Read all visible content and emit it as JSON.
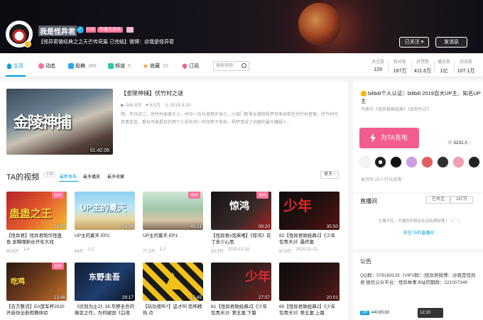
{
  "header": {
    "username": "我是怪异君",
    "level": "LV6",
    "vip_label": "年度大会员",
    "signature": "【怪异君微经典之之天芒传奇篇 已完结】微博：@我是怪异君",
    "follow_label": "已关注 ▾",
    "message_label": "发消息"
  },
  "nav": {
    "tabs": [
      {
        "label": "主页",
        "count": ""
      },
      {
        "label": "动态",
        "count": ""
      },
      {
        "label": "投稿",
        "count": "385"
      },
      {
        "label": "频道",
        "count": "5"
      },
      {
        "label": "收藏",
        "count": "10"
      },
      {
        "label": "订阅",
        "count": ""
      }
    ],
    "search_placeholder": "搜索视频"
  },
  "stats": [
    {
      "label": "关注数",
      "value": "129"
    },
    {
      "label": "粉丝数",
      "value": "187万"
    },
    {
      "label": "获赞数",
      "value": "411.6万"
    },
    {
      "label": "播放数",
      "value": "1亿"
    },
    {
      "label": "阅读数",
      "value": "107.1万"
    }
  ],
  "featured": {
    "title": "【金陵神捕】伏竹村之谜",
    "thumb_text": "金陵神捕",
    "duration": "01:42:09",
    "plays": "246.8万",
    "likes": "6.5万",
    "date": "2019-9-20",
    "description": "明、冬日初二。伏竹村血案大火。村中一位长者意外身亡。六扇门新晋女捕快杨梦音奉命前往伏竹村查案。伏竹村内怪事连连，看似可能是另的两个人却在同一时间死于非命，杨梦音成了凶案的最大嫌疑人..."
  },
  "videos_section": {
    "title": "TA的视频",
    "count": "138",
    "sorts": [
      "最新发布",
      "最多播放",
      "最多收藏"
    ],
    "more_label": "更多 ›"
  },
  "videos": [
    {
      "title": "【怪异君】怪异君制作怪蛊 鱼 发糊喂粉丝开年大戏",
      "duration": "26:25",
      "plays": "90.6万",
      "extra": "1-6",
      "tag": "合作",
      "thumb_text": "蛊蛊之王"
    },
    {
      "title": "UP主的夏天 EP2",
      "duration": "54:38",
      "plays": "64万",
      "extra": "1-2",
      "tag": "",
      "thumb_text": "UP主的夏天"
    },
    {
      "title": "UP主的夏天 EP1",
      "duration": "40:11",
      "plays": "77.2万",
      "extra": "1-2",
      "tag": "合作",
      "thumb_text": ""
    },
    {
      "title": "【怪异君x泡芙嘻】《惊鸿》花了多少心思",
      "duration": "09:20",
      "plays": "33.3万",
      "extra": "2020-12-31",
      "tag": "合作",
      "thumb_text": "惊鸿"
    },
    {
      "title": "62【怪异君致经典2】《少年包青天3》最终案",
      "duration": "35:50",
      "plays": "87.6万",
      "extra": "2020-11-12",
      "tag": "",
      "thumb_text": "少年"
    },
    {
      "title": "【吉方整活】EA莲军杯2020 开启你全新观赛体验",
      "duration": "13:46",
      "plays": "",
      "extra": "",
      "tag": "合作",
      "thumb_text": "吃鸡"
    },
    {
      "title": "《侦到为止2》18.东野圭吾的蝌变之作，为何被毁《白夜",
      "duration": "28:17",
      "plays": "",
      "extra": "",
      "tag": "",
      "thumb_text": "东野圭吾"
    },
    {
      "title": "【玩功夜听?】这才叫 恐怖精 热 点",
      "duration": "15:45",
      "plays": "",
      "extra": "",
      "tag": "",
      "thumb_text": ""
    },
    {
      "title": "61【怪异君致经典2】《少年包青天3》第五案 下篇",
      "duration": "27:07",
      "plays": "",
      "extra": "",
      "tag": "",
      "thumb_text": "少年"
    },
    {
      "title": "60【怪异君致经典2】《少年包青天3》第五案 上篇",
      "duration": "20:01",
      "plays": "",
      "extra": "",
      "tag": "",
      "thumb_text": ""
    }
  ],
  "sidebar": {
    "cert": "bilibili个人认证：bilibili 2019百大UP主、知名UP主",
    "cert_sub": "代表作《怪异君致经典》《侦到为止》",
    "charge_label": "为TA充电",
    "fans_prefix": "共",
    "fans_count": "5231人",
    "fan_note": "本月共 22人为TA充电",
    "live_title": "直播间",
    "live_follow": "已关注",
    "live_fans": "187万",
    "live_note": "主播不在，开播的时候会在动态通知哦 (￣▽￣)",
    "live_link": "前往TA的直播间",
    "notice_title": "公告",
    "notice_text": "QQ群：576163133（VIP2群）|怪异君微博：@我是怪异君 微信公众平台：怪异故事 B站同期群：221007349",
    "uid": "4408538",
    "uid_tag": "UID",
    "badge": "12:10"
  },
  "colors": {
    "accent": "#00a1d6",
    "pink": "#fb7299",
    "charge": "#f25d8e"
  }
}
